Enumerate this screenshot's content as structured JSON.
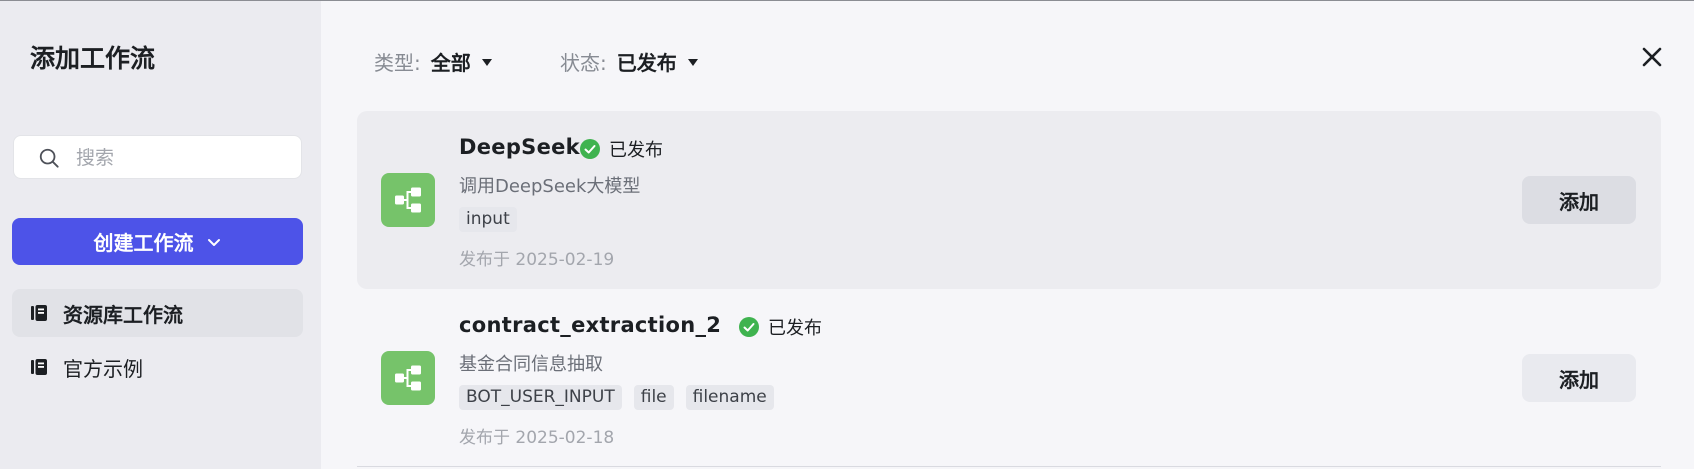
{
  "sidebar": {
    "title": "添加工作流",
    "search": {
      "placeholder": "搜索",
      "value": ""
    },
    "create_button": "创建工作流",
    "nav": [
      {
        "label": "资源库工作流",
        "active": true
      },
      {
        "label": "官方示例",
        "active": false
      }
    ]
  },
  "filters": {
    "type": {
      "label": "类型:",
      "value": "全部"
    },
    "status": {
      "label": "状态:",
      "value": "已发布"
    }
  },
  "workflows": [
    {
      "name": "DeepSeek",
      "status": "已发布",
      "description": "调用DeepSeek大模型",
      "tags": [
        "input"
      ],
      "date": "发布于 2025-02-19",
      "add_label": "添加"
    },
    {
      "name": "contract_extraction_2",
      "status": "已发布",
      "description": "基金合同信息抽取",
      "tags": [
        "BOT_USER_INPUT",
        "file",
        "filename"
      ],
      "date": "发布于 2025-02-18",
      "add_label": "添加"
    }
  ],
  "icons": {
    "search": "search-icon",
    "chevron": "chevron-down-icon",
    "library": "library-book-icon",
    "close": "close-icon",
    "workflow": "workflow-icon",
    "published": "check-circle-icon"
  },
  "colors": {
    "primary": "#4d53e8",
    "workflow_icon_bg": "#76c36a",
    "published_green": "#3fb34f"
  }
}
